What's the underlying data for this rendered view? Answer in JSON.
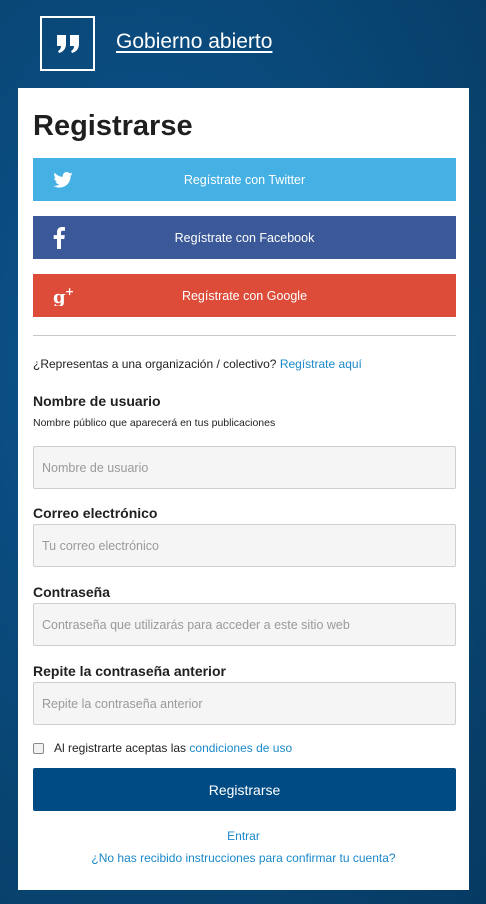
{
  "header": {
    "site_title": "Gobierno abierto",
    "logo_icon": "quote-icon"
  },
  "form": {
    "title": "Registrarse",
    "social": [
      {
        "label": "Regístrate con Twitter",
        "icon": "twitter-icon",
        "color": "#45b0e3"
      },
      {
        "label": "Regístrate con Facebook",
        "icon": "facebook-icon",
        "color": "#3b5998"
      },
      {
        "label": "Regístrate con Google",
        "icon": "google-plus-icon",
        "color": "#dd4b39"
      }
    ],
    "organization_text": "¿Representas a una organización / colectivo?",
    "organization_link": "Regístrate aquí",
    "username": {
      "label": "Nombre de usuario",
      "help": "Nombre público que aparecerá en tus publicaciones",
      "placeholder": "Nombre de usuario",
      "value": ""
    },
    "email": {
      "label": "Correo electrónico",
      "placeholder": "Tu correo electrónico",
      "value": ""
    },
    "password": {
      "label": "Contraseña",
      "placeholder": "Contraseña que utilizarás para acceder a este sitio web",
      "value": ""
    },
    "password_confirm": {
      "label": "Repite la contraseña anterior",
      "placeholder": "Repite la contraseña anterior",
      "value": ""
    },
    "terms": {
      "checked": false,
      "text": "Al registrarte aceptas las",
      "link": "condiciones de uso"
    },
    "submit_label": "Registrarse",
    "signin_link": "Entrar",
    "confirm_link": "¿No has recibido instrucciones para confirmar tu cuenta?"
  },
  "colors": {
    "background": "#08436f",
    "primary": "#004b84",
    "link": "#1a88c9"
  }
}
